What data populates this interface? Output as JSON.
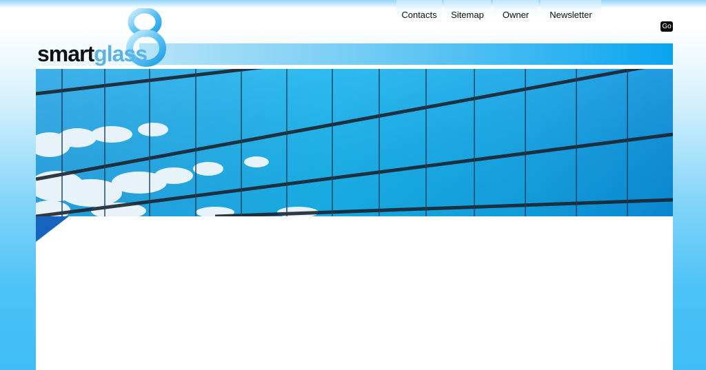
{
  "brand": {
    "name_part1": "smart",
    "name_part2": "glass",
    "logo_colors": {
      "dark": "#111111",
      "light": "#5ab3e8"
    }
  },
  "nav": {
    "items": [
      {
        "label": "Contacts"
      },
      {
        "label": "Sitemap"
      },
      {
        "label": "Owner"
      },
      {
        "label": "Newsletter"
      }
    ]
  },
  "search": {
    "go_label": "Go"
  },
  "hero": {
    "image_icon": "glass-building-facade-image"
  },
  "colors": {
    "accent": "#0aa4ef",
    "band_light": "#b8e4f8",
    "background_bottom": "#3fbdf6",
    "corner_accent": "#1565c0"
  }
}
